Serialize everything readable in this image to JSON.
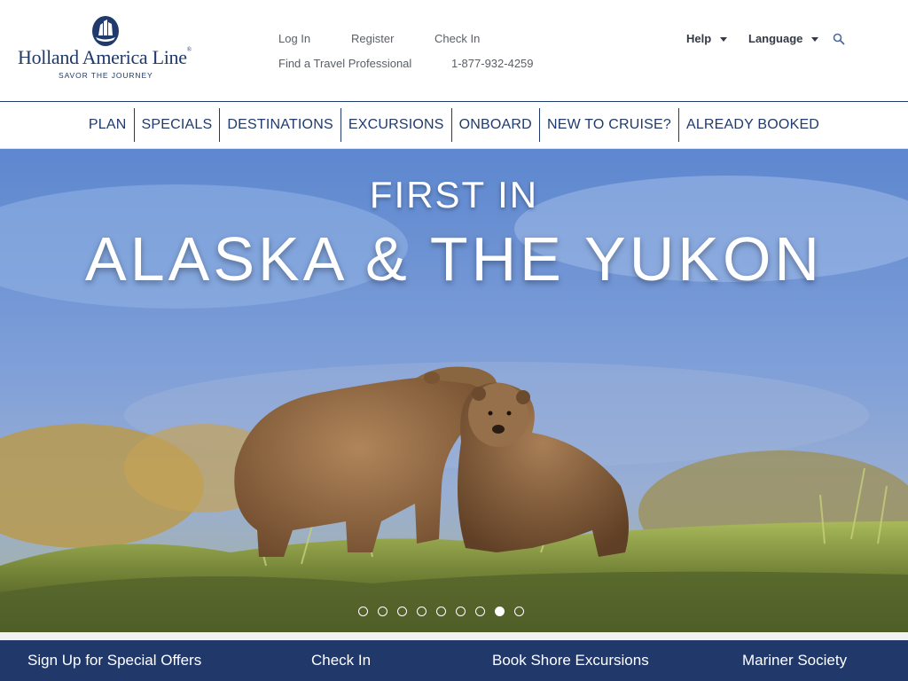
{
  "brand": {
    "name": "Holland America Line",
    "registered": "®",
    "tagline": "SAVOR THE JOURNEY",
    "primary_color": "#1f3a6b"
  },
  "utility_nav": {
    "login": "Log In",
    "register": "Register",
    "check_in": "Check In",
    "find_travel_pro": "Find a Travel Professional",
    "phone": "1-877-932-4259",
    "help": "Help",
    "language": "Language",
    "search_icon": "search-icon"
  },
  "main_nav": {
    "items": [
      {
        "label": "PLAN"
      },
      {
        "label": "SPECIALS"
      },
      {
        "label": "DESTINATIONS"
      },
      {
        "label": "EXCURSIONS"
      },
      {
        "label": "ONBOARD"
      },
      {
        "label": "NEW TO CRUISE?"
      },
      {
        "label": "ALREADY BOOKED"
      }
    ]
  },
  "hero": {
    "eyebrow": "FIRST IN",
    "title": "ALASKA & THE YUKON",
    "slide_count": 9,
    "active_slide": 8
  },
  "footer_bar": {
    "links": [
      {
        "label": "Sign Up for Special Offers"
      },
      {
        "label": "Check In"
      },
      {
        "label": "Book Shore Excursions"
      },
      {
        "label": "Mariner Society"
      }
    ],
    "background": "#21386b"
  }
}
